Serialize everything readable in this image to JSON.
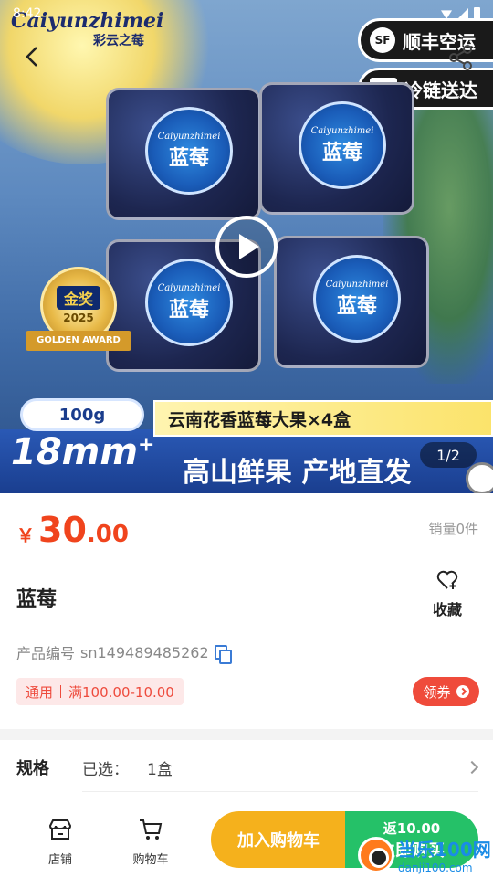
{
  "status_bar": {
    "time": "8:42"
  },
  "hero": {
    "brand_script": "Caiyunzhimei",
    "brand_cn": "彩云之莓",
    "shipping_badges": [
      {
        "logo": "SF",
        "label": "顺丰空运"
      },
      {
        "label": "冷链送达"
      }
    ],
    "box_labels": [
      {
        "script": "Caiyunzhimei",
        "name": "蓝莓"
      },
      {
        "script": "Caiyunzhimei",
        "name": "蓝莓"
      },
      {
        "script": "Caiyunzhimei",
        "name": "蓝莓"
      },
      {
        "script": "Caiyunzhimei",
        "name": "蓝莓"
      }
    ],
    "award": {
      "title": "金奖",
      "year": "2025",
      "ribbon": "GOLDEN AWARD"
    },
    "weight_pill": "100g",
    "product_banner": "云南花香蓝莓大果×4盒",
    "size_text": "18mm",
    "size_sup": "+",
    "slogan": "高山鲜果 产地直发",
    "page_indicator": "1/2"
  },
  "product": {
    "currency": "￥",
    "price_int": "30",
    "price_dec": ".00",
    "sales_label": "销量",
    "sales_value": "0件",
    "title": "蓝莓",
    "favorite_label": "收藏",
    "sku_label": "产品编号",
    "sku_value": "sn149489485262",
    "coupon_tag": "通用",
    "coupon_rule": "满100.00-10.00",
    "claim_button": "领券"
  },
  "spec": {
    "label": "规格",
    "selected_label": "已选：",
    "selected_value": "1盒"
  },
  "bottom_bar": {
    "store_label": "店铺",
    "cart_label": "购物车",
    "add_to_cart": "加入购物车",
    "buy_rebate": "返10.00",
    "buy_now": "立即购买"
  },
  "watermark": {
    "t1": "当乐100网",
    "t2": "danji100.com"
  },
  "colors": {
    "price_red": "#f0441d",
    "add_cart_orange": "#f5b11c",
    "buy_green": "#25c168",
    "coupon_red": "#ee4b3d"
  },
  "icons": [
    "back-icon",
    "share-icon",
    "play-icon",
    "heart-plus-icon",
    "copy-icon",
    "chevron-right-icon",
    "store-icon",
    "cart-icon"
  ]
}
